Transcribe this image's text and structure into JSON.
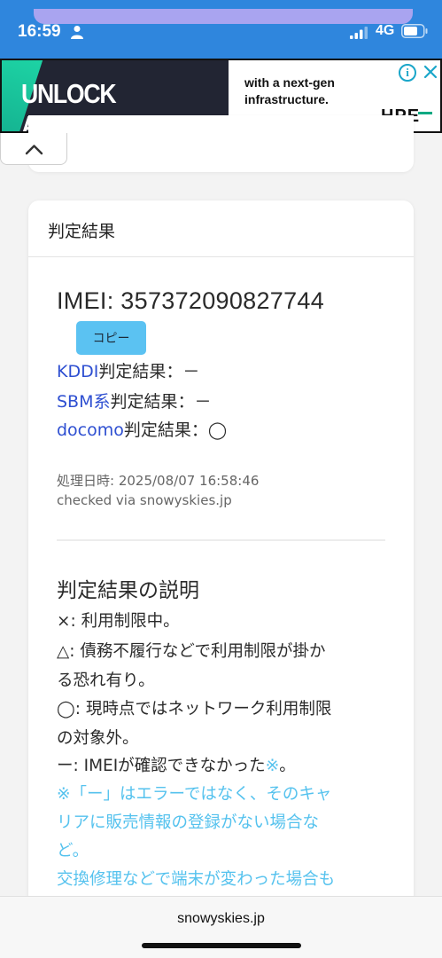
{
  "status_bar": {
    "time": "16:59",
    "network": "4G"
  },
  "ad": {
    "headline": "UNLOCK AMBITION",
    "text": "with a next-gen infrastructure.",
    "brand": "HPE",
    "info_icon": "i",
    "colors": {
      "dark": "#222533",
      "accent": "#1ed6a6",
      "info": "#1aa6c9"
    }
  },
  "result_card": {
    "title": "判定結果",
    "imei": "IMEI: 357372090827744",
    "copy_label": "コピー",
    "results": [
      {
        "carrier": "KDDI",
        "label": "判定結果：－"
      },
      {
        "carrier": "SBM系",
        "label": "判定結果：－"
      },
      {
        "carrier": "docomo",
        "label": "判定結果：◯"
      }
    ],
    "processed_at": "処理日時: 2025/08/07 16:58:46",
    "checked_via": "checked via snowyskies.jp"
  },
  "explanation": {
    "title": "判定結果の説明",
    "lines": [
      "×: 利用制限中。",
      "△: 債務不履行などで利用制限が掛か",
      "る恐れ有り。",
      "◯: 現時点ではネットワーク利用制限",
      "の対象外。"
    ],
    "dash_line": "ー: IMEIが確認できなかった",
    "dash_note_mark": "※",
    "dash_line_end": "。",
    "notes": [
      "※「ー」はエラーではなく、そのキャ",
      "リアに販売情報の登録がない場合な",
      "ど。",
      "交換修理などで端末が変わった場合も"
    ]
  },
  "url_bar": {
    "url": "snowyskies.jp"
  },
  "colors": {
    "status_bar": "#2f86dd",
    "link": "#2e4fd1",
    "copy_button": "#5bc2f2",
    "note": "#55c2ee"
  }
}
